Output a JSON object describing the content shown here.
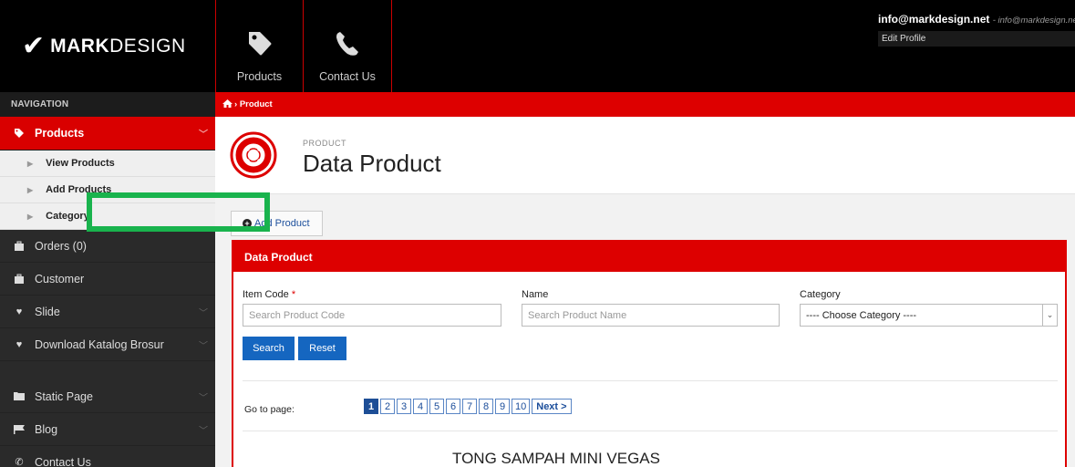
{
  "header": {
    "logo_bold": "MARK",
    "logo_light": "DESIGN",
    "nav": [
      {
        "label": "Products",
        "icon": "tag-icon"
      },
      {
        "label": "Contact Us",
        "icon": "phone-icon"
      }
    ],
    "user_email": "info@markdesign.net",
    "user_email_sub": "- info@markdesign.net",
    "edit_profile": "Edit Profile"
  },
  "sidebar": {
    "title": "NAVIGATION",
    "items": [
      {
        "label": "Products",
        "icon": "tag-icon",
        "active": true
      },
      {
        "label": "View Products"
      },
      {
        "label": "Add Products"
      },
      {
        "label": "Category"
      },
      {
        "label": "Orders (0)",
        "icon": "briefcase-icon"
      },
      {
        "label": "Customer",
        "icon": "briefcase-icon"
      },
      {
        "label": "Slide",
        "icon": "heart-icon"
      },
      {
        "label": "Download Katalog Brosur",
        "icon": "heart-icon"
      },
      {
        "label": "Static Page",
        "icon": "folder-icon"
      },
      {
        "label": "Blog",
        "icon": "flag-icon"
      },
      {
        "label": "Contact Us",
        "icon": "phone-icon"
      }
    ]
  },
  "breadcrumb": {
    "label": "Product"
  },
  "page": {
    "subtitle": "PRODUCT",
    "title": "Data Product",
    "add_button": "Add Product"
  },
  "panel": {
    "title": "Data Product",
    "fields": {
      "item_code_label": "Item Code",
      "item_code_required": "*",
      "item_code_placeholder": "Search Product Code",
      "name_label": "Name",
      "name_placeholder": "Search Product Name",
      "category_label": "Category",
      "category_selected": "---- Choose Category ----"
    },
    "search_button": "Search",
    "reset_button": "Reset",
    "goto_label": "Go to page:",
    "pages": [
      "1",
      "2",
      "3",
      "4",
      "5",
      "6",
      "7",
      "8",
      "9",
      "10"
    ],
    "current_page": "1",
    "next_label": "Next >",
    "first_product": "TONG SAMPAH MINI VEGAS"
  },
  "colors": {
    "accent": "#d00000",
    "highlight": "#19b34d",
    "button_blue": "#1566c0"
  }
}
